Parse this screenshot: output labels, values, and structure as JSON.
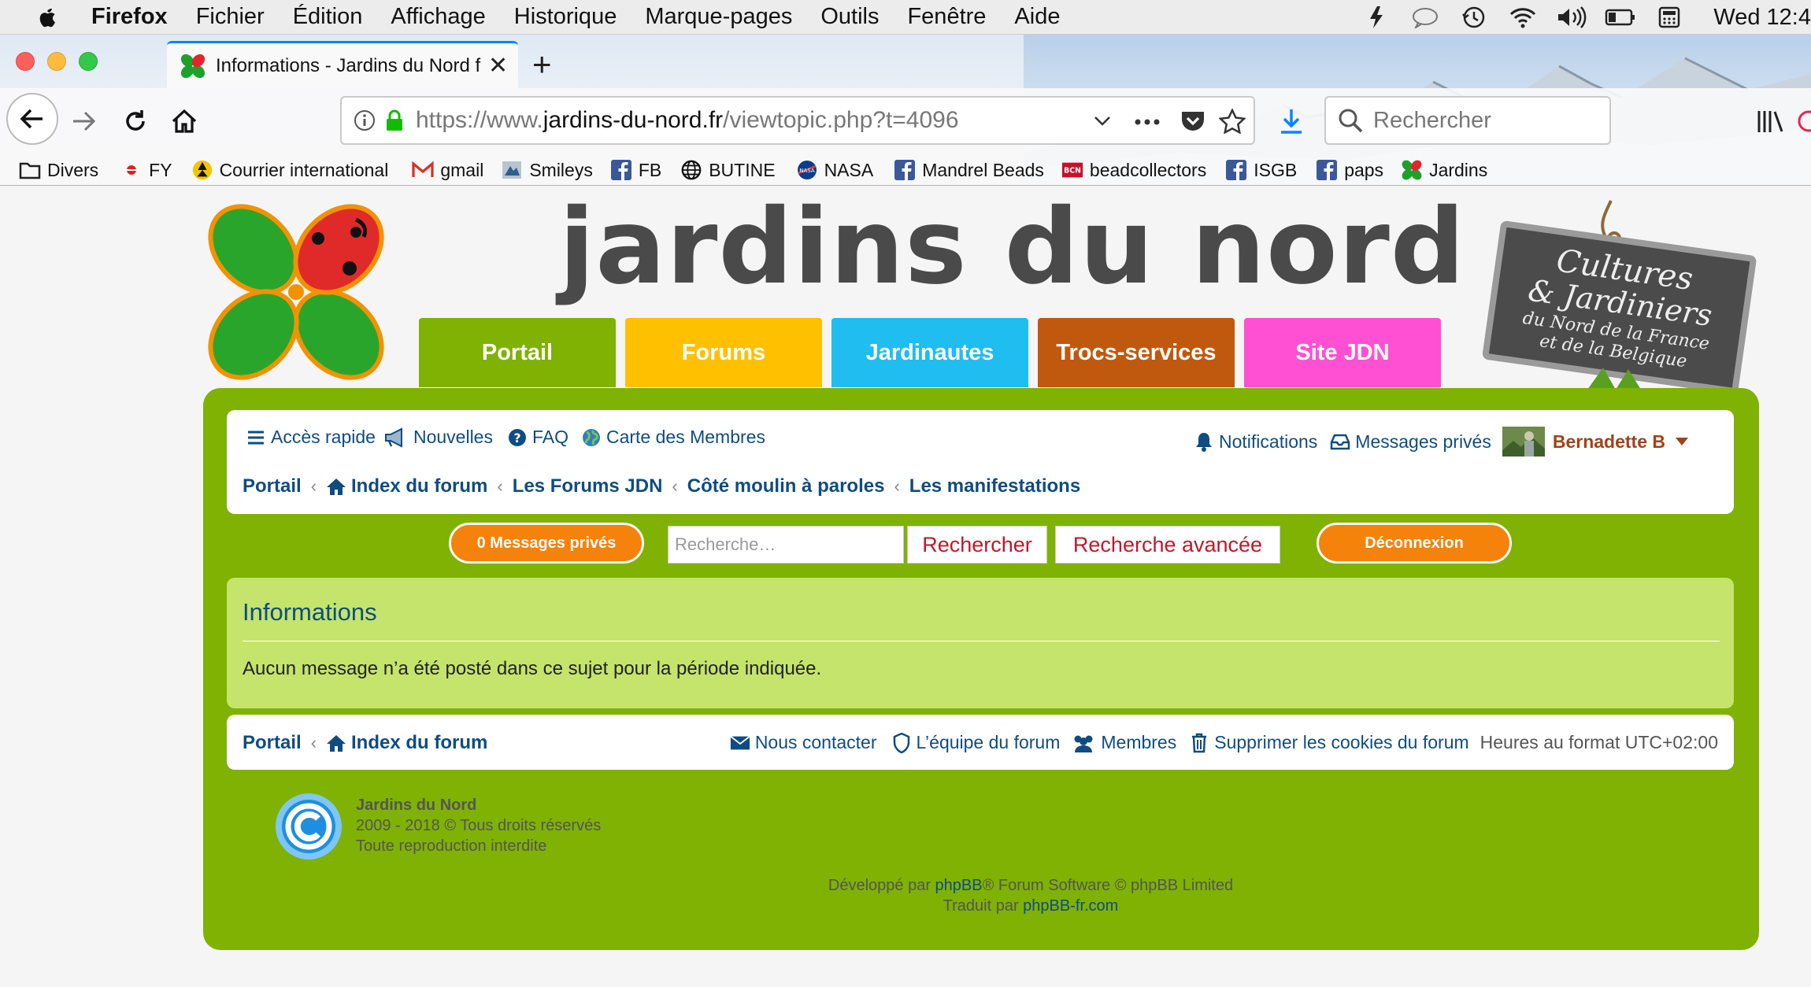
{
  "menubar": {
    "app": "Firefox",
    "items": [
      "Fichier",
      "Édition",
      "Affichage",
      "Historique",
      "Marque-pages",
      "Outils",
      "Fenêtre",
      "Aide"
    ],
    "clock": "Wed 12:4"
  },
  "tab": {
    "title": "Informations - Jardins du Nord f",
    "close": "✕",
    "new": "+"
  },
  "address": {
    "prefix": "https://www.",
    "host": "jardins-du-nord.fr",
    "path": "/viewtopic.php?t=4096"
  },
  "search": {
    "placeholder": "Rechercher"
  },
  "bookmarks": [
    {
      "label": "Divers",
      "icon": "folder-icon"
    },
    {
      "label": "FY",
      "icon": "fy-icon"
    },
    {
      "label": "Courrier international",
      "icon": "globe-icon"
    },
    {
      "label": "gmail",
      "icon": "gmail-icon"
    },
    {
      "label": "Smileys",
      "icon": "smileys-icon"
    },
    {
      "label": "FB",
      "icon": "facebook-icon"
    },
    {
      "label": "BUTINE",
      "icon": "globe-icon"
    },
    {
      "label": "NASA",
      "icon": "nasa-icon"
    },
    {
      "label": "Mandrel Beads",
      "icon": "facebook-icon"
    },
    {
      "label": "beadcollectors",
      "icon": "bcn-icon"
    },
    {
      "label": "ISGB",
      "icon": "facebook-icon"
    },
    {
      "label": "paps",
      "icon": "facebook-icon"
    },
    {
      "label": "Jardins",
      "icon": "jardins-icon"
    }
  ],
  "site": {
    "title": "jardins du nord",
    "sign": [
      "Cultures",
      "& Jardiniers",
      "du Nord de la France",
      "et de la Belgique"
    ]
  },
  "navtabs": [
    {
      "label": "Portail",
      "color": "#7fb202"
    },
    {
      "label": "Forums",
      "color": "#ffc000"
    },
    {
      "label": "Jardinautes",
      "color": "#1fbdf0"
    },
    {
      "label": "Trocs-services",
      "color": "#c0580e"
    },
    {
      "label": "Site JDN",
      "color": "#ff4fd2"
    }
  ],
  "quicklinks": {
    "acces_rapide": "Accès rapide",
    "nouvelles": "Nouvelles",
    "faq": "FAQ",
    "carte": "Carte des Membres",
    "notifications": "Notifications",
    "messages_prives": "Messages privés",
    "user": "Bernadette B"
  },
  "breadcrumbs": [
    "Portail",
    "Index du forum",
    "Les Forums JDN",
    "Côté moulin à paroles",
    "Les manifestations"
  ],
  "toolbar": {
    "pm_button": "0 Messages privés",
    "search_placeholder": "Recherche…",
    "search_button": "Rechercher",
    "advanced_button": "Recherche avancée",
    "logout_button": "Déconnexion"
  },
  "info": {
    "title": "Informations",
    "message": "Aucun message n’a été posté dans ce sujet pour la période indiquée."
  },
  "footer": {
    "crumbs": [
      "Portail",
      "Index du forum"
    ],
    "contact": "Nous contacter",
    "team": "L’équipe du forum",
    "members": "Membres",
    "cookies": "Supprimer les cookies du forum",
    "timezone": "Heures au format UTC+02:00",
    "copy_name": "Jardins du Nord",
    "copy_years": "2009 - 2018 © Tous droits réservés",
    "copy_repro": "Toute reproduction interdite",
    "dev_prefix": "Développé par ",
    "dev_link": "phpBB",
    "dev_suffix": "® Forum Software © phpBB Limited",
    "trans_prefix": "Traduit par ",
    "trans_link": "phpBB-fr.com"
  },
  "colors": {
    "green": "#7fb202",
    "info_bg": "#c4e46c",
    "link": "#0f4c81",
    "orange": "#f5820a",
    "red_button_text": "#c0182a"
  }
}
